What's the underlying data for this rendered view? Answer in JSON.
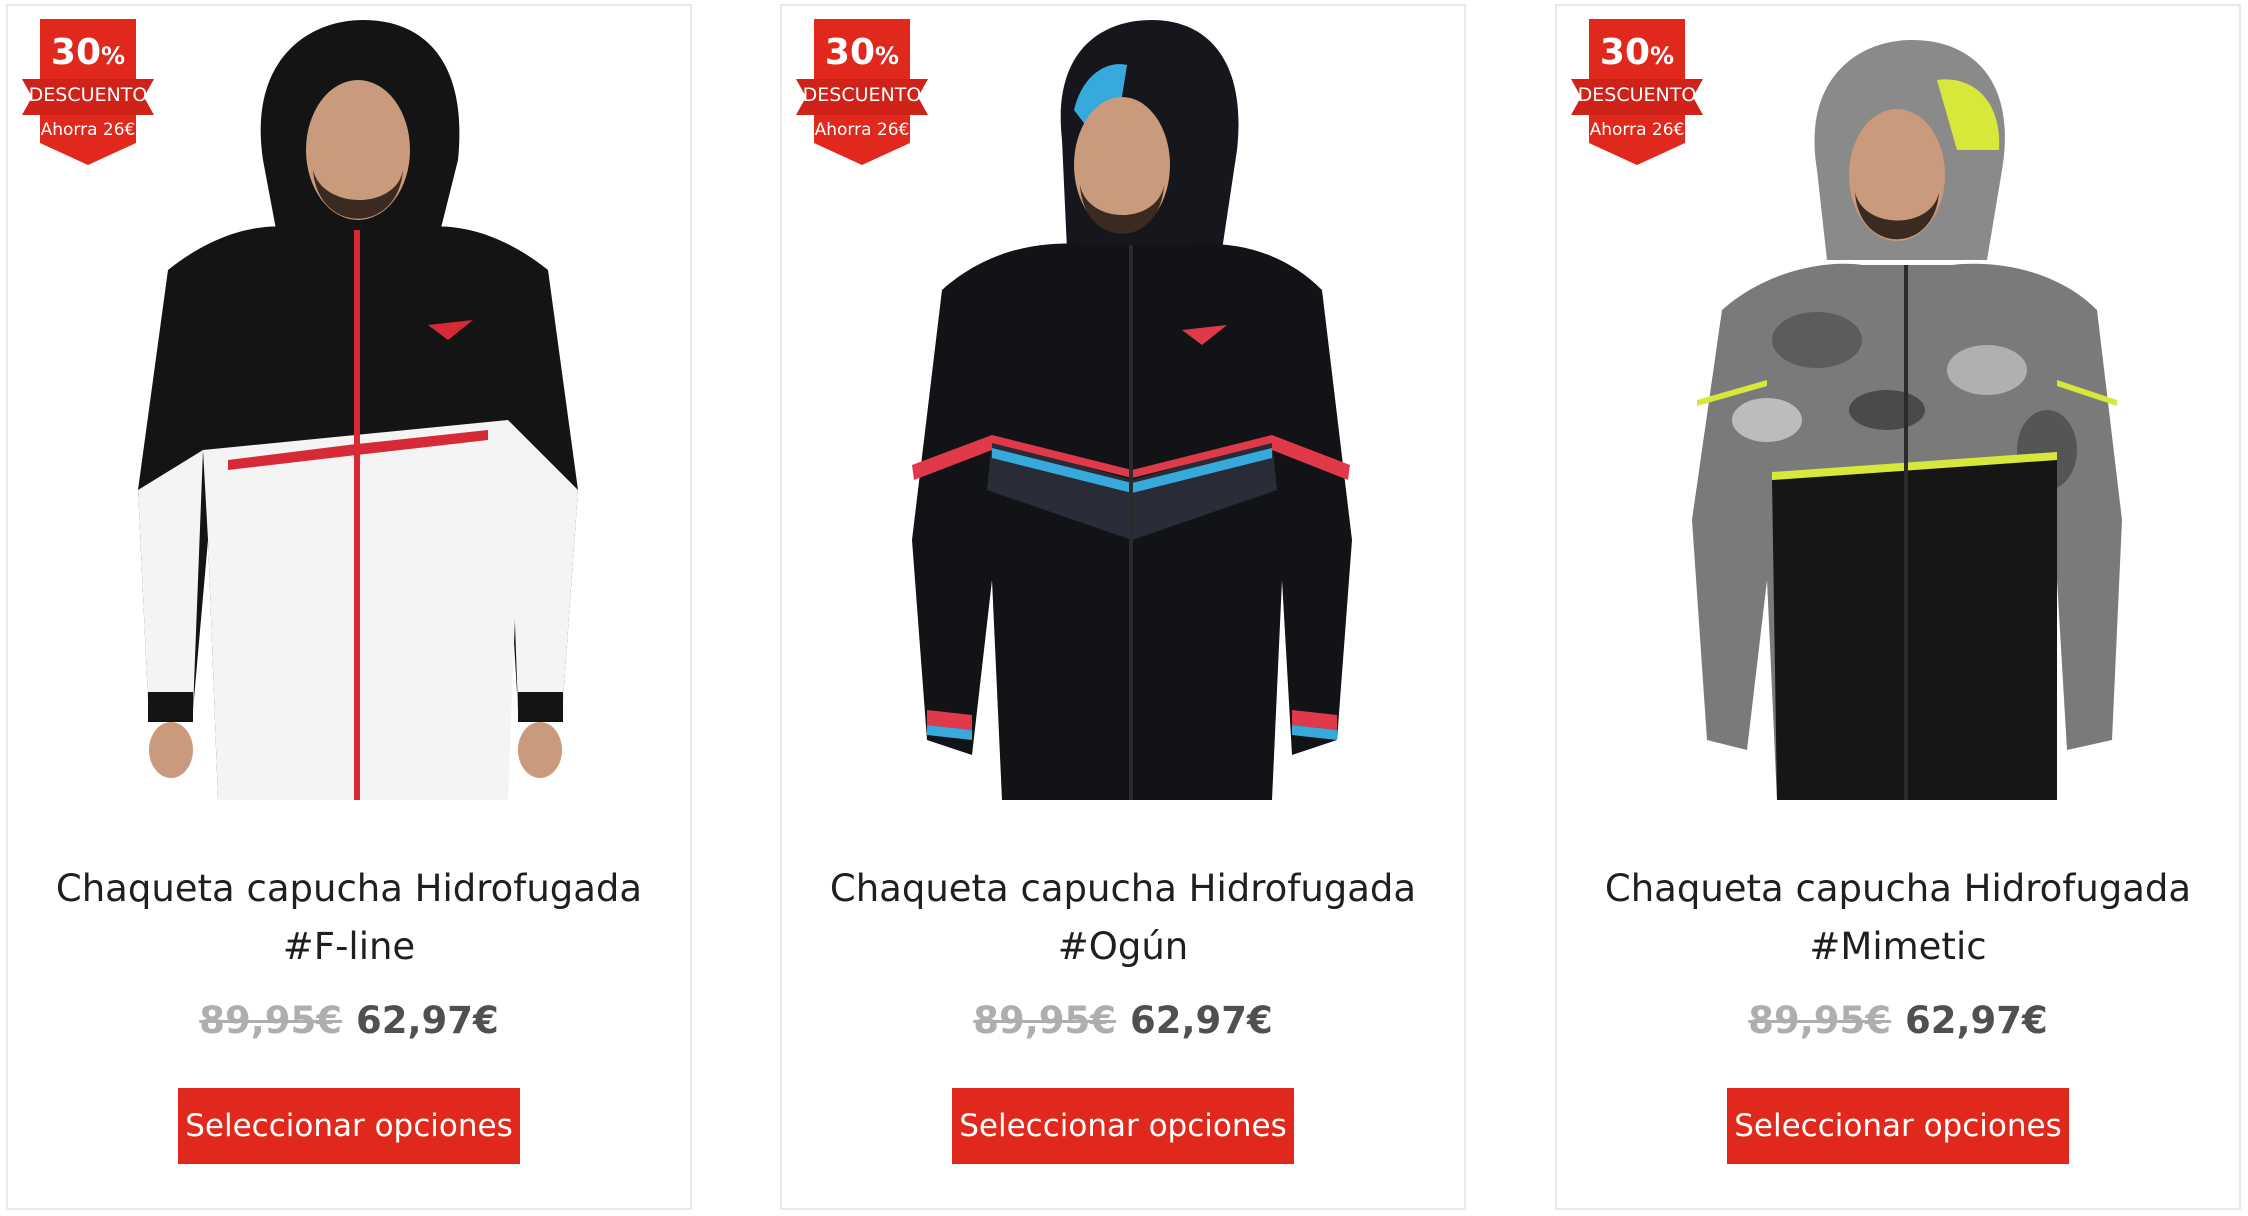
{
  "products": [
    {
      "badge": {
        "percent": "30",
        "percent_sign": "%",
        "label": "DESCUENTO",
        "savings": "Ahorra 26€"
      },
      "image_alt": "Chaqueta capucha Hidrofugada #F-line",
      "title": "Chaqueta capucha Hidrofugada #F-line",
      "old_price": "89,95€",
      "new_price": "62,97€",
      "button_label": "Seleccionar opciones",
      "colors": {
        "top": "#111111",
        "bottom": "#f4f4f4",
        "accent": "#d62a37",
        "sleeve": "#141414"
      }
    },
    {
      "badge": {
        "percent": "30",
        "percent_sign": "%",
        "label": "DESCUENTO",
        "savings": "Ahorra 26€"
      },
      "image_alt": "Chaqueta capucha Hidrofugada #Ogún",
      "title": "Chaqueta capucha Hidrofugada #Ogún",
      "old_price": "89,95€",
      "new_price": "62,97€",
      "button_label": "Seleccionar opciones",
      "colors": {
        "top": "#121316",
        "bottom": "#1b1d24",
        "accent": "#e03a4a",
        "accent2": "#37a9dc",
        "sleeve": "#121316"
      }
    },
    {
      "badge": {
        "percent": "30",
        "percent_sign": "%",
        "label": "DESCUENTO",
        "savings": "Ahorra 26€"
      },
      "image_alt": "Chaqueta capucha Hidrofugada #Mimetic",
      "title": "Chaqueta capucha Hidrofugada #Mimetic",
      "old_price": "89,95€",
      "new_price": "62,97€",
      "button_label": "Seleccionar opciones",
      "colors": {
        "top": "#7a7a7a",
        "bottom": "#161616",
        "accent": "#d7e83a",
        "sleeve": "#6d6d6d"
      }
    }
  ],
  "theme": {
    "brand_red": "#e0281c",
    "badge_red": "#e0281c"
  }
}
